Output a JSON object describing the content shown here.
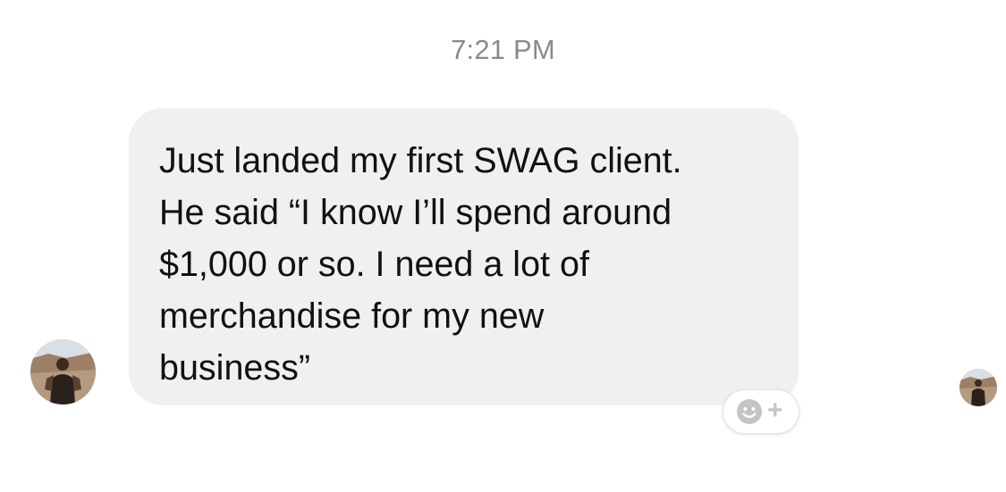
{
  "conversation": {
    "timestamp": "7:21 PM",
    "message": {
      "lines": [
        "Just landed my first SWAG client.",
        "He said “I know I’ll spend around",
        "$1,000 or so. I need a lot of",
        "merchandise for my new",
        "business”"
      ]
    },
    "reaction_button": {
      "icon": "smiley-face-icon",
      "plus": "+"
    }
  },
  "colors": {
    "bubble_background": "#f0f0f0",
    "timestamp_text": "#8a8a8e",
    "message_text": "#111111",
    "reaction_icon": "#c4c4c4"
  }
}
